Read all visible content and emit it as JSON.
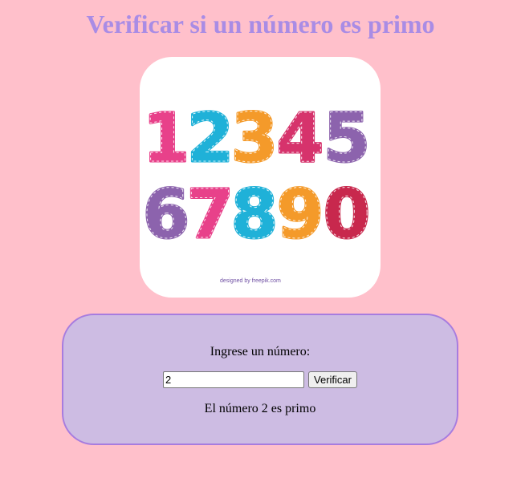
{
  "page": {
    "title": "Verificar si un número es primo",
    "background_color": "#ffc0cb",
    "title_color": "#a98ce5"
  },
  "image": {
    "rows": [
      [
        "1",
        "2",
        "3",
        "4",
        "5"
      ],
      [
        "6",
        "7",
        "8",
        "9",
        "0"
      ]
    ],
    "digit_colors": [
      "#e8418a",
      "#1fb1d8",
      "#f49a2a",
      "#d6336c",
      "#8c63ad",
      "#8c63ad",
      "#e8418a",
      "#1fb1d8",
      "#f49a2a",
      "#c8284d"
    ],
    "credit": "designed by freepik.com"
  },
  "form": {
    "prompt": "Ingrese un número:",
    "input_value": "2",
    "button_label": "Verificar",
    "result": "El número 2 es primo",
    "panel_color": "#cdbce3",
    "panel_border_color": "#a77cdf"
  }
}
